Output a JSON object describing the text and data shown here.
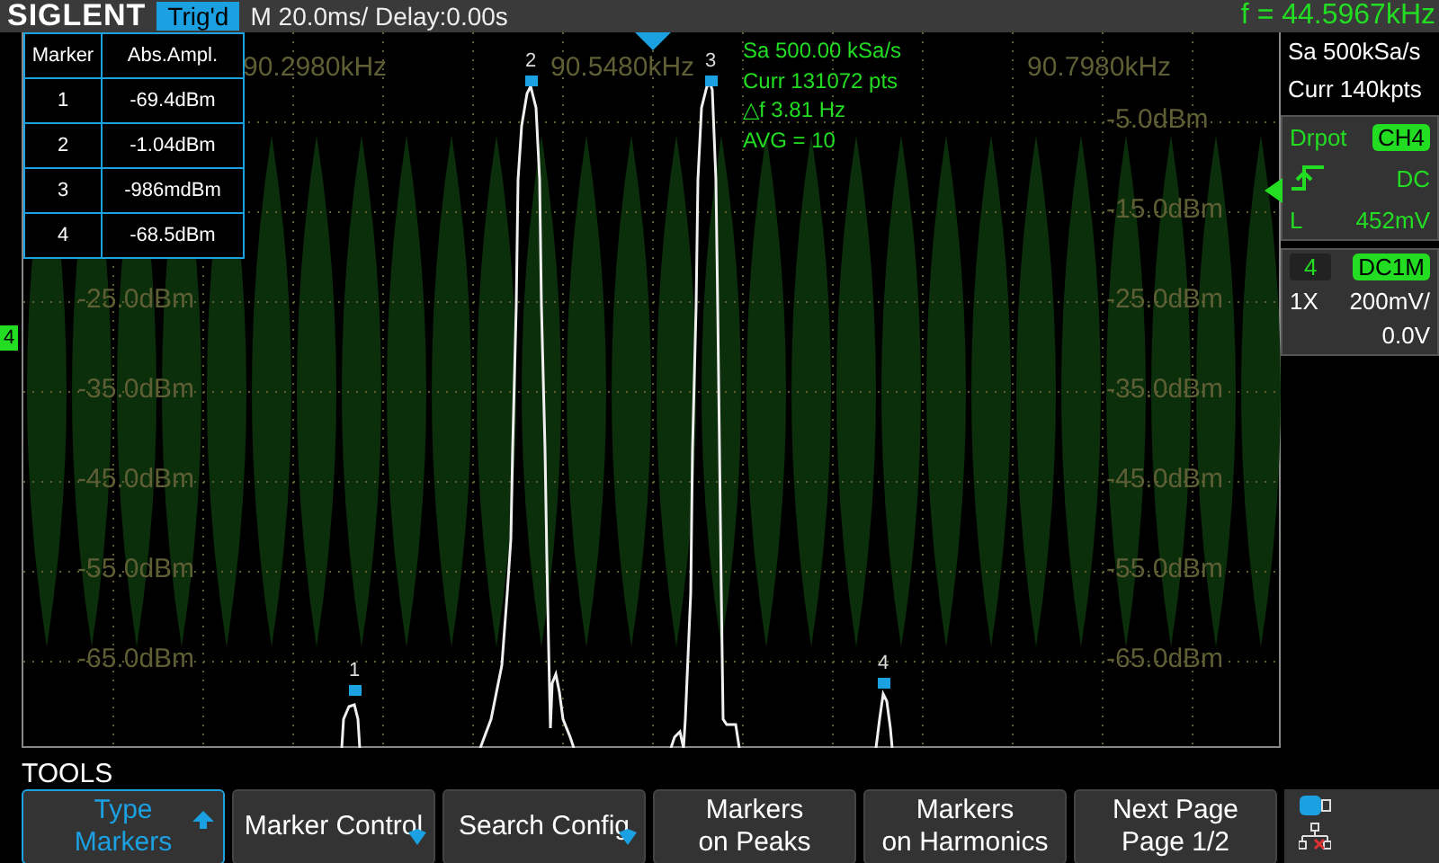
{
  "top_bar": {
    "logo": "SIGLENT",
    "trigger_status": "Trig'd",
    "timebase": "M 20.0ms/ Delay:0.00s",
    "frequency": "f = 44.5967kHz"
  },
  "marker_table": {
    "columns": [
      "Marker",
      "Abs.Ampl."
    ],
    "rows": [
      [
        "1",
        "-69.4dBm"
      ],
      [
        "2",
        "-1.04dBm"
      ],
      [
        "3",
        "-986mdBm"
      ],
      [
        "4",
        "-68.5dBm"
      ]
    ]
  },
  "measurements": [
    "Sa 500.00 kSa/s",
    "Curr 131072 pts",
    "△f 3.81 Hz",
    "AVG = 10"
  ],
  "freq_labels": [
    "90.2980kHz",
    "90.5480kHz",
    "90.7980kHz"
  ],
  "level_labels_left": [
    "-25.0dBm",
    "-35.0dBm",
    "-45.0dBm",
    "-55.0dBm",
    "-65.0dBm"
  ],
  "level_labels_right": [
    "-5.0dBm",
    "-15.0dBm",
    "-25.0dBm",
    "-35.0dBm",
    "-45.0dBm",
    "-55.0dBm",
    "-65.0dBm"
  ],
  "markers": [
    "1",
    "2",
    "3",
    "4"
  ],
  "channel_marker": "4",
  "acquisition": {
    "sample_rate": "Sa 500kSa/s",
    "memory": "Curr 140kpts"
  },
  "trigger": {
    "mode": "Drpot",
    "source": "CH4",
    "coupling": "DC",
    "level_label": "L",
    "level_value": "452mV"
  },
  "channel": {
    "number": "4",
    "coupling": "DC1M",
    "probe": "1X",
    "scale": "200mV/",
    "offset": "0.0V"
  },
  "menu": {
    "title": "TOOLS",
    "buttons": [
      {
        "lines": [
          "Type",
          "Markers"
        ],
        "kind": "toggle",
        "selected": true
      },
      {
        "lines": [
          "Marker Control"
        ],
        "kind": "submenu",
        "selected": false
      },
      {
        "lines": [
          "Search Config"
        ],
        "kind": "submenu",
        "selected": false
      },
      {
        "lines": [
          "Markers",
          "on Peaks"
        ],
        "kind": "plain",
        "selected": false
      },
      {
        "lines": [
          "Markers",
          "on Harmonics"
        ],
        "kind": "plain",
        "selected": false
      },
      {
        "lines": [
          "Next Page",
          "Page 1/2"
        ],
        "kind": "plain",
        "selected": false
      }
    ]
  }
}
